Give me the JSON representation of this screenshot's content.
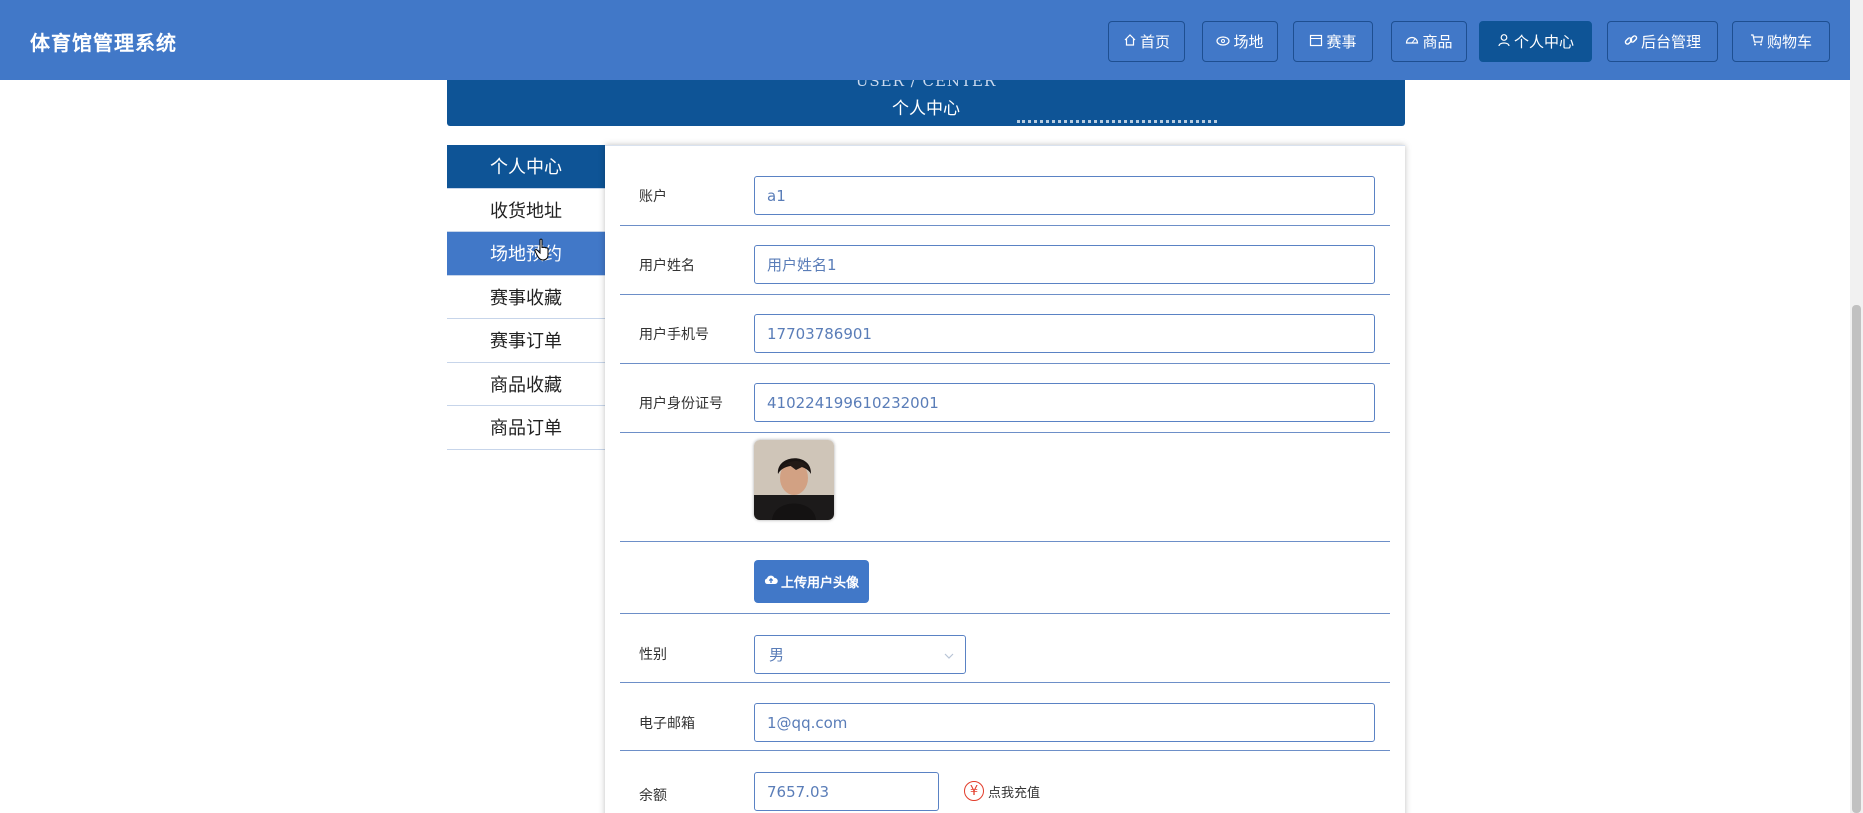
{
  "app": {
    "title": "体育馆管理系统"
  },
  "nav": {
    "items": [
      {
        "label": "首页",
        "icon": "home-icon"
      },
      {
        "label": "场地",
        "icon": "venue-icon"
      },
      {
        "label": "赛事",
        "icon": "calendar-icon"
      },
      {
        "label": "商品",
        "icon": "goods-icon"
      },
      {
        "label": "个人中心",
        "icon": "user-icon",
        "active": true
      },
      {
        "label": "后台管理",
        "icon": "link-icon"
      },
      {
        "label": "购物车",
        "icon": "cart-icon"
      }
    ]
  },
  "banner": {
    "title_en": "USER / CENTER",
    "title_zh": "个人中心"
  },
  "sidebar": {
    "items": [
      {
        "label": "个人中心",
        "state": "active"
      },
      {
        "label": "收货地址"
      },
      {
        "label": "场地预约",
        "state": "hover"
      },
      {
        "label": "赛事收藏"
      },
      {
        "label": "赛事订单"
      },
      {
        "label": "商品收藏"
      },
      {
        "label": "商品订单"
      }
    ]
  },
  "form": {
    "account": {
      "label": "账户",
      "value": "a1"
    },
    "name": {
      "label": "用户姓名",
      "value": "用户姓名1"
    },
    "phone": {
      "label": "用户手机号",
      "value": "17703786901"
    },
    "id_card": {
      "label": "用户身份证号",
      "value": "410224199610232001"
    },
    "upload_label": "上传用户头像",
    "gender": {
      "label": "性别",
      "value": "男"
    },
    "email": {
      "label": "电子邮箱",
      "value": "1@qq.com"
    },
    "balance": {
      "label": "余额",
      "value": "7657.03",
      "recharge_label": "点我充值",
      "recharge_icon": "¥"
    }
  },
  "colors": {
    "primary": "#4178c8",
    "dark": "#0e5496",
    "accent_red": "#e23c2a"
  }
}
